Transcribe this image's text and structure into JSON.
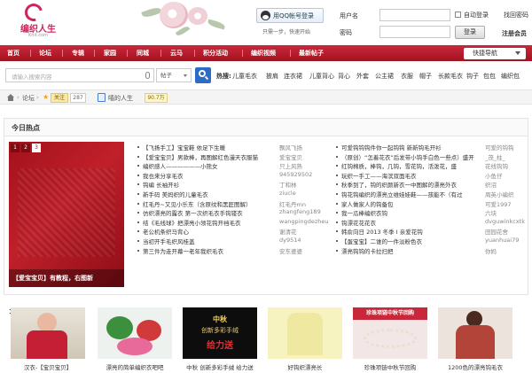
{
  "header": {
    "logo_text": "编织人生",
    "logo_sub": "Knit.com",
    "qq_button": "用QQ帐号登录",
    "qq_links": "只需一步，快速开始",
    "login": {
      "username_label": "用户名",
      "password_label": "密码",
      "auto_login": "自动登录",
      "forgot_password": "找回密码",
      "login_button": "登录",
      "register": "注册会员"
    }
  },
  "nav": {
    "items": [
      "首页",
      "论坛",
      "专辑",
      "家园",
      "同城",
      "云马",
      "积分活动",
      "编织视频",
      "最新帖子"
    ],
    "quick_nav": "快捷导航"
  },
  "search": {
    "placeholder": "请输入搜索内容",
    "scope": "帖子",
    "hot_label": "热搜:",
    "hot_tags": [
      "儿童毛衣",
      "披肩",
      "连衣裙",
      "儿童背心",
      "背心",
      "外套",
      "公主裙",
      "衣服",
      "帽子",
      "长款毛衣",
      "钩子",
      "包包",
      "编织包"
    ]
  },
  "breadcrumb": {
    "forum": "论坛",
    "follow": "关注",
    "count": "287",
    "subscription": "嘻的人生",
    "points": "90.7万"
  },
  "hot": {
    "title": "今日热点",
    "slide_pages": [
      "1",
      "2",
      "3"
    ],
    "slide_caption": "【爱宝宝贝】有教程，右图新",
    "posts_left": [
      {
        "title": "【飞扬手工】宝宝鞋 依足下生暖",
        "author": "飘风飞扬"
      },
      {
        "title": "【爱宝宝贝】男款棒，再图解红色漫天衣服猫",
        "author": "爱宝宝贝"
      },
      {
        "title": "编织感人——————小熊女",
        "author": "只上风熟"
      },
      {
        "title": "我也来分享毛衣",
        "author": "945929502"
      },
      {
        "title": "钩编 长袖开衫",
        "author": "丁和林"
      },
      {
        "title": "新手码 美妈织的儿童毛衣",
        "author": "ziucle"
      },
      {
        "title": "红毛丹~又见小乐东（含原纹和黑匠图解）",
        "author": "红毛丹mn"
      },
      {
        "title": "仿织漂亮的露衣 第一次织毛衣手钩镂衣",
        "author": "zhangfeng189"
      },
      {
        "title": "结《毛线球》把漂亮小领花钩开裆毛衣",
        "author": "wangpingdezheu"
      },
      {
        "title": "老公机条织马背心",
        "author": "谢清花"
      },
      {
        "title": "当初开手毛织风桂盖",
        "author": "dy9514"
      },
      {
        "title": "第三件为走开幕一老年我织毛衣",
        "author": "安东婆婆"
      }
    ],
    "posts_right": [
      {
        "title": "可爱钩钩钩件你一起钩钩 新新钩毛开衫",
        "author": "可爱的钩钩"
      },
      {
        "title": "（原创）“怎着花衣”后发带小钩手白色一些点）盛开",
        "author": "_茂_柱_"
      },
      {
        "title": "红钩棉质，棒钩，几钩，雪花钩，活泼花，盛",
        "author": "花线钩钩"
      },
      {
        "title": "玩织一手工——海滨双面毛衣",
        "author": "小鱼仔"
      },
      {
        "title": "秋季到了，钩的织颜新衣一中图解的漂亮外衣",
        "author": "织沼"
      },
      {
        "title": "钩花钩编织的漂亮立维娃娃鞋——孩能不（有过",
        "author": "周英小编织"
      },
      {
        "title": "家人做家人的钩备包",
        "author": "可爱1997"
      },
      {
        "title": "我一瓜棒编织衣钩",
        "author": "六块"
      },
      {
        "title": "钩漂花花花衣",
        "author": "dvguwinkcxtk"
      },
      {
        "title": "韩俞向日 2013 冬季 I 亲爱花钩",
        "author": "田园花舍"
      },
      {
        "title": "【蛋宝宝】二谁的一件淡粉色衣",
        "author": "yuanhuai79"
      },
      {
        "title": "漂亮钩钩的卡拉扫把",
        "author": "你妈"
      }
    ]
  },
  "gallery": {
    "num": "1",
    "items": [
      {
        "caption": "汉衣-【宝贝宝贝】"
      },
      {
        "caption": "漂亮的简单编织衣吧吧"
      },
      {
        "caption": "中秋 创新多彩手绒 给力送",
        "banner_lines": [
          "中秋",
          "创新多彩手绒",
          "给力送"
        ]
      },
      {
        "caption": "好钩织漂亮长"
      },
      {
        "caption": "珍珠项链中秋节回购",
        "banner_lines": [
          "珍珠项链中秋节回购"
        ]
      },
      {
        "caption": "1200色的漂亮钩毛衣"
      }
    ]
  }
}
